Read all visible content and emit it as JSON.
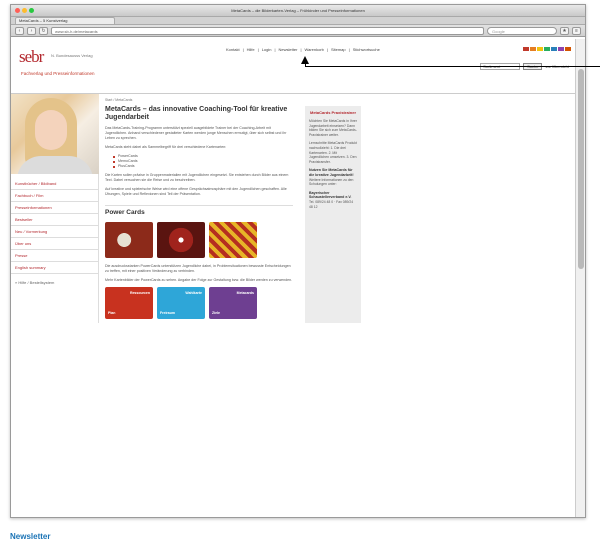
{
  "browser": {
    "window_title": "MetaCards – die Bilderkarten-Verlag – Frühkinder und Presseinformationen",
    "tab_label": "MetaCards – 5 Kunstverlag",
    "url": "www.sb-h.de/metacards",
    "search_placeholder": "Google"
  },
  "site": {
    "logo_mark": "sebr",
    "logo_name": "N. Bundesausss Verlag",
    "logo_sub": "Fachverlag und Presseinformationen",
    "topnav": [
      "Kontakt",
      "Hilfe",
      "Login",
      "Newsletter",
      "Warenkorb",
      "Sitemap",
      "Stichwortsuche"
    ],
    "search_select": "Sortiment",
    "search_button": "Suche",
    "search_extra": "zur Übersicht",
    "colors": [
      "#c0392b",
      "#e67e22",
      "#f1c40f",
      "#27ae60",
      "#2980b9",
      "#8e44ad",
      "#d35400"
    ]
  },
  "sidebar": {
    "items": [
      "Kunstbücher / Bildband",
      "Fachbuch / Film",
      "Presseinformationen",
      "Bestseller",
      "Neu / Vormerkung",
      "Über uns",
      "Presse",
      "English summary"
    ],
    "footer": "» Hilfe / Bestellsystem"
  },
  "main": {
    "breadcrumb": "Start / MetaCards",
    "title": "MetaCards – das innovative Coaching-Tool für kreative Jugendarbeit",
    "intro": "Das MetaCards-Training-Programm unterstützt speziell ausgebildete Trainer bei der Coaching-Arbeit mit Jugendlichen. Anhand verschiedener gestalteter Karten werden junge Menschen ermutigt, über sich selbst und ihr Leben zu sprechen.",
    "subline": "MetaCards steht dabei als Sammelbegriff für drei verschiedene Kartenarten:",
    "bullets": [
      "PowerCards",
      "MemoCards",
      "PlusCards"
    ],
    "para2": "Die Karten sollen präzise in Gruppenmaterialien mit Jugendlichen eingesetzt. Sie entstehen durch Bilder aus einem Text. Dabei versuchen sie die Reise und zu beschreiben.",
    "para3": "Auf kreative und spielerische Weise wird eine offene Gesprächsatmosphäre mit den Jugendlichen geschaffen. Alle Übungen, Spiele und Reflexionen sind Teil der Präsentation.",
    "section_title": "Power Cards",
    "section_text": "Die ausdrucksstarken PowerCards unterstützen Jugendliche dabei, in Problemsituationen bewusste Entscheidungen zu treffen, mit einer positiven Veränderung zu verbinden.",
    "section_text2": "Mehr Kartenbilder der PowerCards zu sehen. Angabe der Folge zur Gestaltung bzw. die Bilder werden zu verwenden.",
    "pcards": [
      {
        "top": "Ressourcen",
        "bottom": "Plan"
      },
      {
        "top": "Wahlkarte",
        "bottom": "Freiraum"
      },
      {
        "top": "Metacards",
        "bottom": "Ziele"
      }
    ]
  },
  "right": {
    "heading": "MetaCards Praxistrainer",
    "p1": "Möchten Sie MetaCards in Ihrer Jugendarbeit einsetzen? Dann bilden Sie sich zum MetaCards-Praxistrainer weiter.",
    "p2": "Lernschritte MetaCards Produkt nachvollzieht: 1. Die drei Kartenarten. 2. Mit Jugendlichen umsetzen. 3. Den Praxistransfer.",
    "b1": "Nutzen Sie MetaCards für die kreative Jugendarbeit!",
    "p3": "Weitere Informationen zu den Schulungen unter:",
    "b2": "Bayerischer Schaustellerverband e.V.",
    "p4": "Tel. 089/24 48 0 · Fax 089/24 48 12"
  },
  "caption": "Newsletter"
}
